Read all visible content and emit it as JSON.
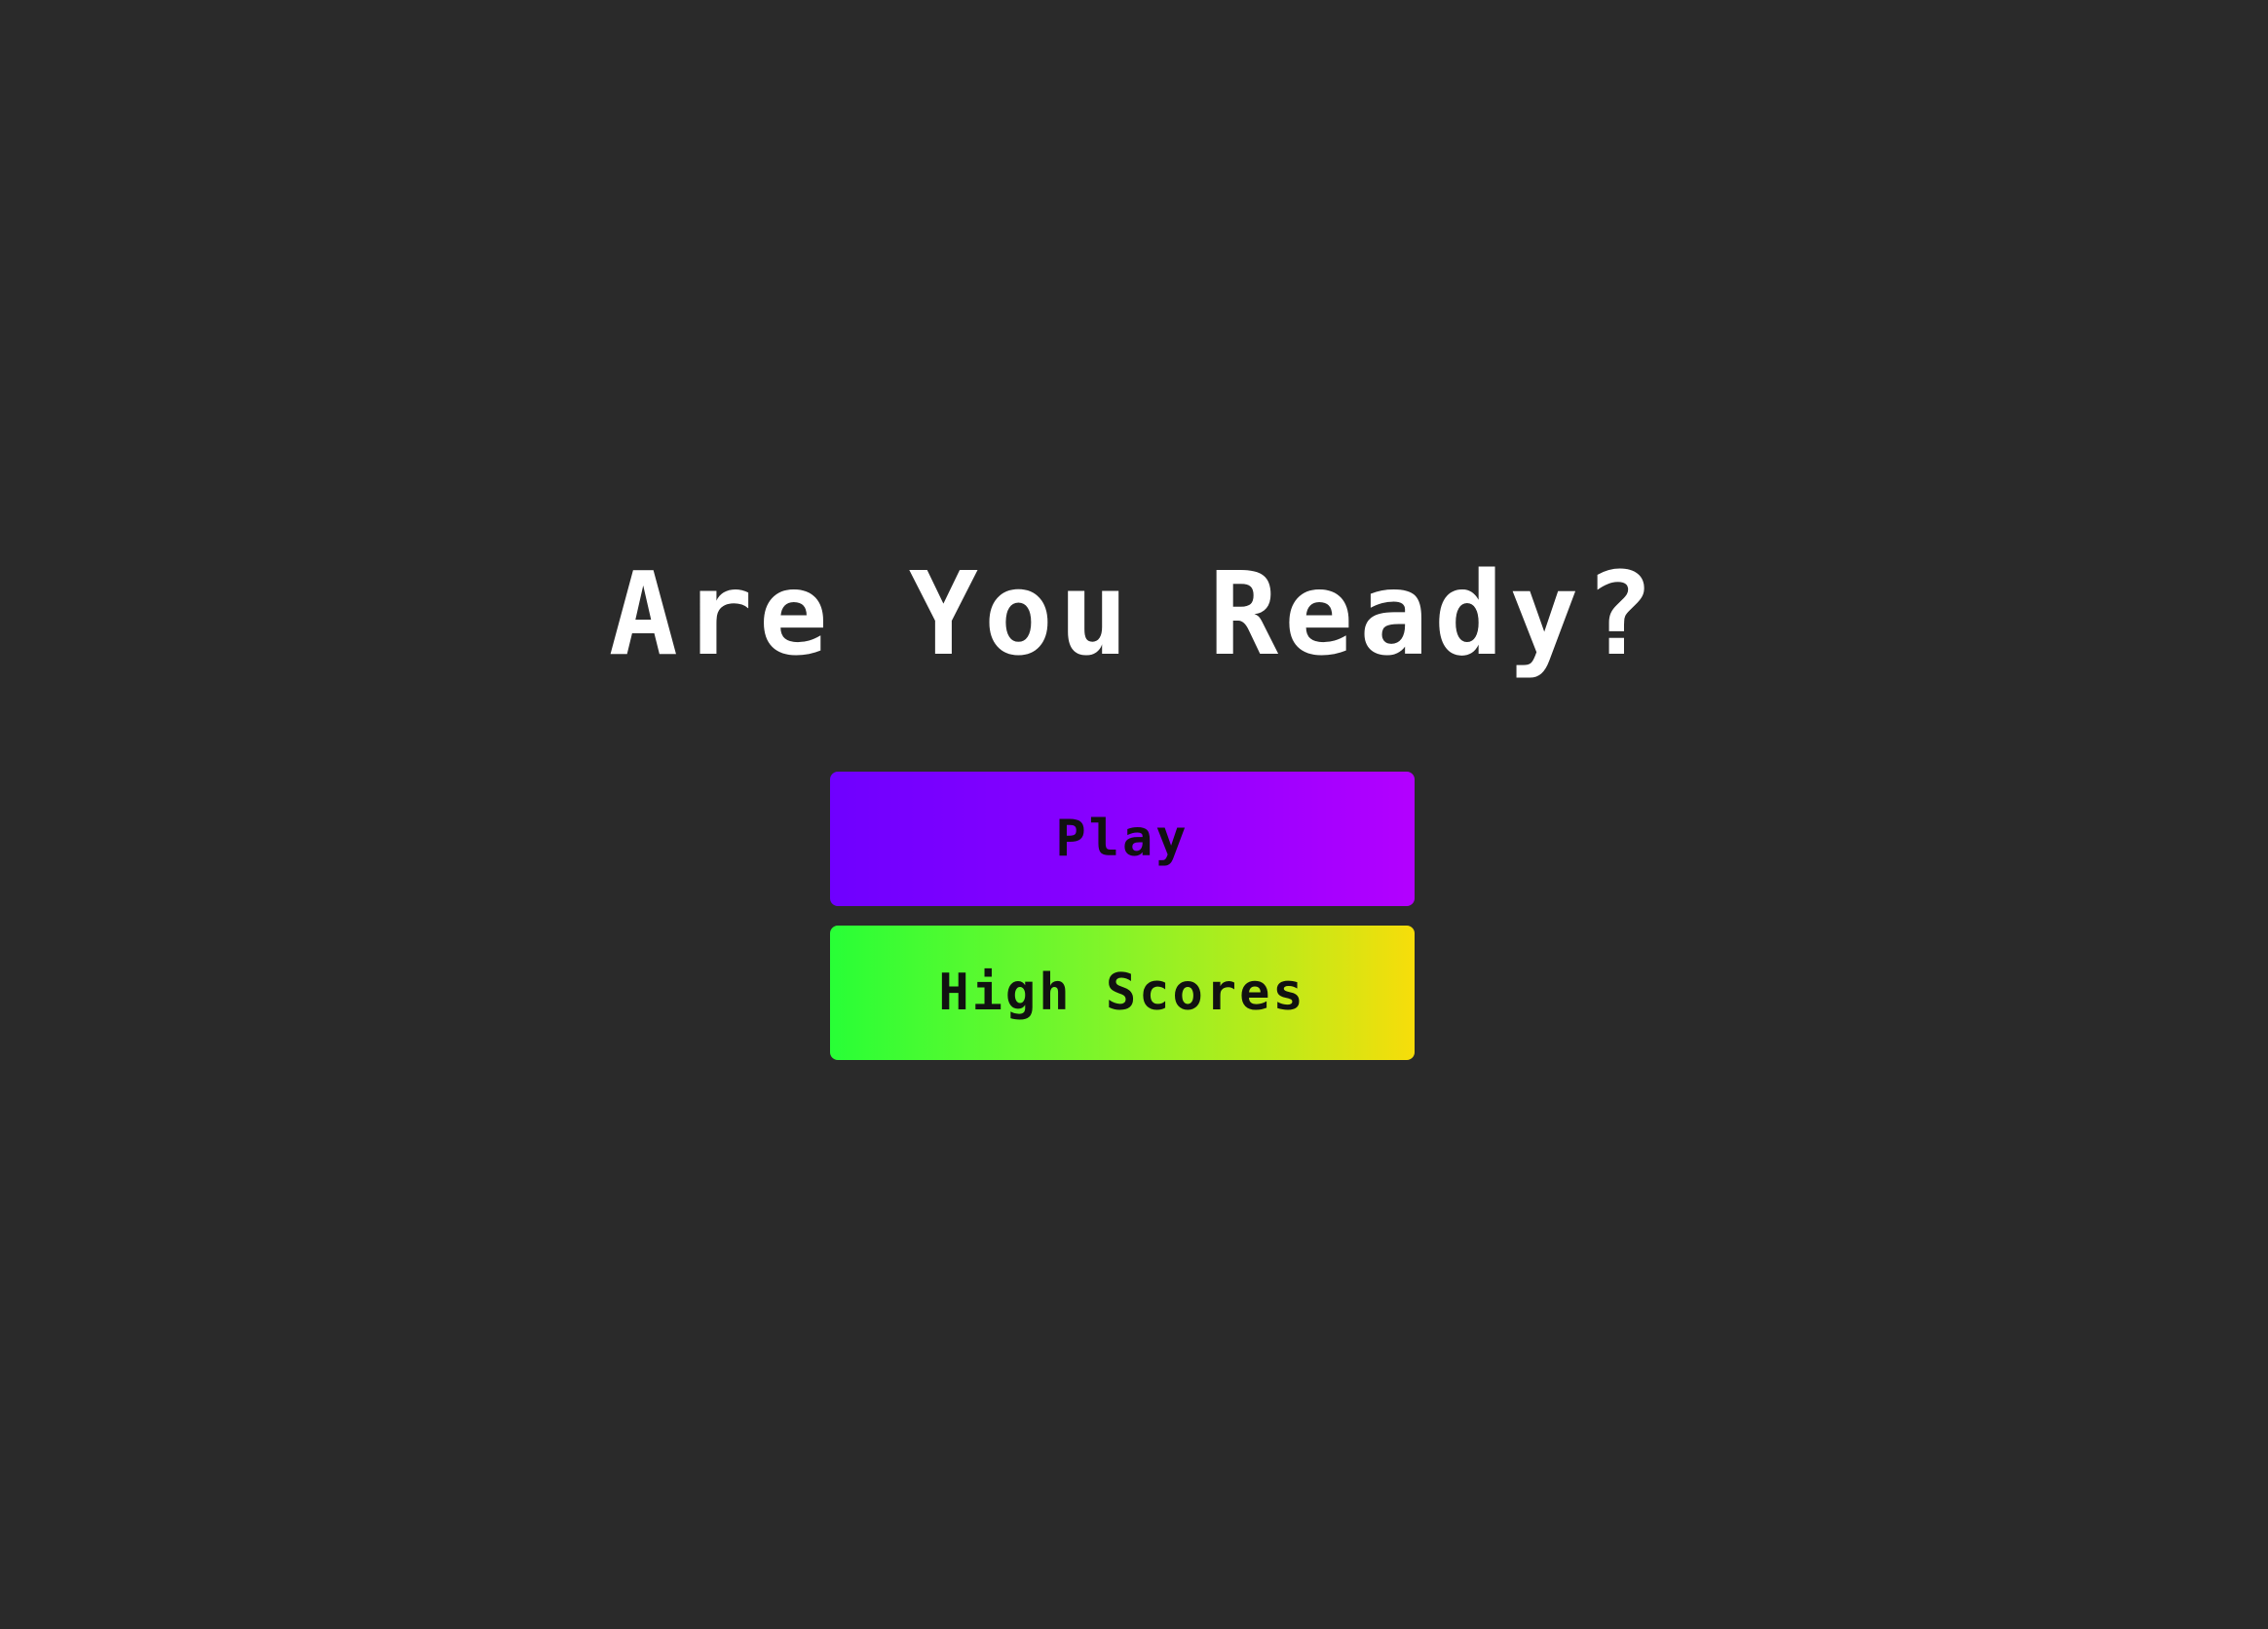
{
  "menu": {
    "title": "Are You Ready?",
    "buttons": {
      "play_label": "Play",
      "high_scores_label": "High Scores"
    }
  },
  "colors": {
    "background": "#2a2a2a",
    "title_text": "#ffffff",
    "play_gradient": [
      "#6f00ff",
      "#b300ff"
    ],
    "high_scores_gradient": [
      "#28ff36",
      "#f7dd0a"
    ],
    "button_text": "#111111"
  }
}
